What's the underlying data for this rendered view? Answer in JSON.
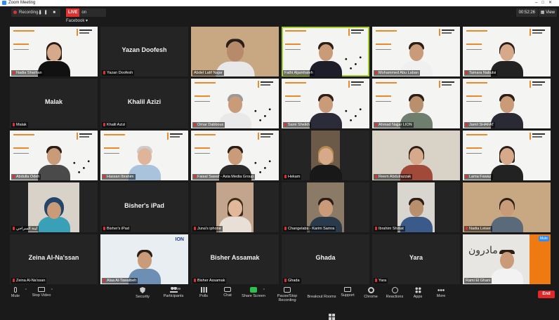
{
  "window": {
    "title": "Zoom Meeting"
  },
  "topbar": {
    "recording_label": "Recording...",
    "live_tag": "LIVE",
    "live_label": "on Facebook",
    "timer": "00:52:26",
    "view_label": "View"
  },
  "tiles": [
    {
      "name": "Nadia Sharhan"
    },
    {
      "name": "Yazan Doofesh",
      "center": "Yazan Doofesh"
    },
    {
      "name": "Abdel Latif Najar"
    },
    {
      "name": "Fathi Aljamhaleh"
    },
    {
      "name": "Mohammed Abu Laban"
    },
    {
      "name": "Tamara Nabulsi"
    },
    {
      "name": "Malak",
      "center": "Malak"
    },
    {
      "name": "Khalil Azizi",
      "center": "Khalil Azizi"
    },
    {
      "name": "Omar Dabbous"
    },
    {
      "name": "Sami Sheikh"
    },
    {
      "name": "Ahmad Najjar LION"
    },
    {
      "name": "Jamil SHAFAT"
    },
    {
      "name": "Abdulla Odeh"
    },
    {
      "name": "Hassan Ibrahim"
    },
    {
      "name": "Faisal Sawaf - Asia Media Group"
    },
    {
      "name": "Hekam"
    },
    {
      "name": "Reem Abdulrazzak"
    },
    {
      "name": "Lama Fawaz"
    },
    {
      "name": "لينة السراجي"
    },
    {
      "name": "Bisher's iPad",
      "center": "Bisher's iPad"
    },
    {
      "name": "Juna's iphone"
    },
    {
      "name": "Changelabs - Karim Samra"
    },
    {
      "name": "Ibrahim Shmat"
    },
    {
      "name": "Nadia Leiser"
    },
    {
      "name": "Zeina Al-Na'ssan",
      "center": "Zeina Al-Na'ssan"
    },
    {
      "name": "Alaa Al-Tawalbeh"
    },
    {
      "name": "Bisher Assamak",
      "center": "Bisher Assamak"
    },
    {
      "name": "Ghada",
      "center": "Ghada"
    },
    {
      "name": "Yara",
      "center": "Yara"
    },
    {
      "name": "Rami El Ghani"
    }
  ],
  "tile_extras": {
    "ion_logo": "ION",
    "arabic_brand": "مادرون",
    "rename_tag": "Mute"
  },
  "toolbar": {
    "mute": "Mute",
    "stop_video": "Stop Video",
    "security": "Security",
    "participants": "Participants",
    "participants_count": "39",
    "polls": "Polls",
    "chat": "Chat",
    "share_screen": "Share Screen",
    "record": "Pause/Stop Recording",
    "breakout": "Breakout Rooms",
    "support": "Support",
    "chrome": "Chrome",
    "reactions": "Reactions",
    "apps": "Apps",
    "more": "More",
    "end": "End"
  },
  "colors": {
    "background": "#1a1a1a",
    "tile": "#242424",
    "active_speaker": "#a7d129",
    "live": "#e03131",
    "share": "#2fbf4f",
    "end": "#e02828"
  }
}
